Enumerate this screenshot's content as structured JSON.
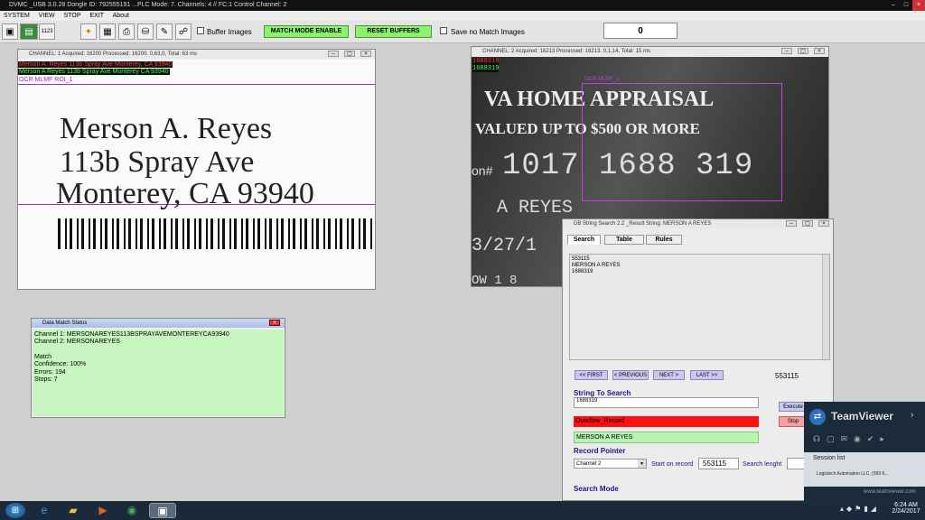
{
  "titlebar": {
    "text": "DVMC _USB 3.0.28  Dongle ID: 792555191  ...PLC Mode: 7. Channels: 4 // FC:1 Control Channel: 2"
  },
  "menu": [
    "SYSTEM",
    "VIEW",
    "STOP",
    "EXIT",
    "About"
  ],
  "toolbar": {
    "buffer_images": "Buffer Images",
    "match_mode": "MATCH MODE ENABLE",
    "reset_buffers": "RESET BUFFERS",
    "save_no_match": "Save no Match Images",
    "counter": "0",
    "btn_1123": "1123"
  },
  "channel1": {
    "title": "CHANNEL: 1 Acquired: 16200 Processed: 16200.  0,63,0, Total: 63 ms",
    "result_red": "Merson A. Reyes 113b Spray Ave Monterey, CA 93940",
    "result_green": "Merson A Reyes 113b Spray Ave Monterey CA 93940",
    "roi": "OCR MLMF ROI_1",
    "line1": "Merson A. Reyes",
    "line2": "113b Spray Ave",
    "line3": "Monterey, CA 93940"
  },
  "channel2": {
    "title": "CHANNEL: 2 Acquired: 16213 Processed: 16213.  0,1,14, Total: 15 ms",
    "res1": "1688319",
    "res2": "1688319",
    "roi": "OCR MLMF_1",
    "card1": "VA HOME APPRAISAL",
    "card2": "VALUED UP TO $500 OR MORE",
    "card_num": "1017 1688 319",
    "card_prefix": "on#",
    "card_name": "A REYES",
    "card_date": "3/27/1",
    "card_bottom": "OW 1 8"
  },
  "match_status": {
    "title": "Data Match Status",
    "lines": [
      "Channel 1: MERSONAREYES113BSPRAYAVEMONTEREYCA93940",
      "Channel 2: MERSONAREYES",
      "",
      "Match",
      "Confidence: 100%",
      "Errors: 194",
      "Stops: 7"
    ]
  },
  "dbsearch": {
    "title": "DB String Search 2.2 _Result String: MERSON A REYES",
    "tabs": [
      "Search",
      "Table",
      "Rules"
    ],
    "results": [
      "553115",
      "MERSON A REYES",
      "1688319"
    ],
    "first": "<< FIRST",
    "previous": "< PREVIOUS",
    "next": "NEXT >",
    "last": "LAST >>",
    "record_no": "553115",
    "string_to_search": "String To Search",
    "search_value": "1688319",
    "execute": "Execute",
    "stop": "Stop",
    "overflow": "Overflow_Record",
    "result_value": "MERSON A REYES",
    "record_pointer": "Record Pointer",
    "channel": "Channel 2",
    "start_on_record": "Start on  record",
    "start_value": "553115",
    "search_length": "Search lenght",
    "search_mode": "Search Mode"
  },
  "teamviewer": {
    "brand": "TeamViewer",
    "session_list": "Session list",
    "session_item": "Logictech Automation LLC. (993 6...",
    "url": "www.teamviewer.com"
  },
  "taskbar": {
    "time": "6:24 AM",
    "date": "2/24/2017"
  },
  "colors": {
    "green_btn": "#8ef06f",
    "red_bar": "#ff1010",
    "green_bar": "#b8f5b0",
    "roi_purple": "#9b30c0"
  }
}
